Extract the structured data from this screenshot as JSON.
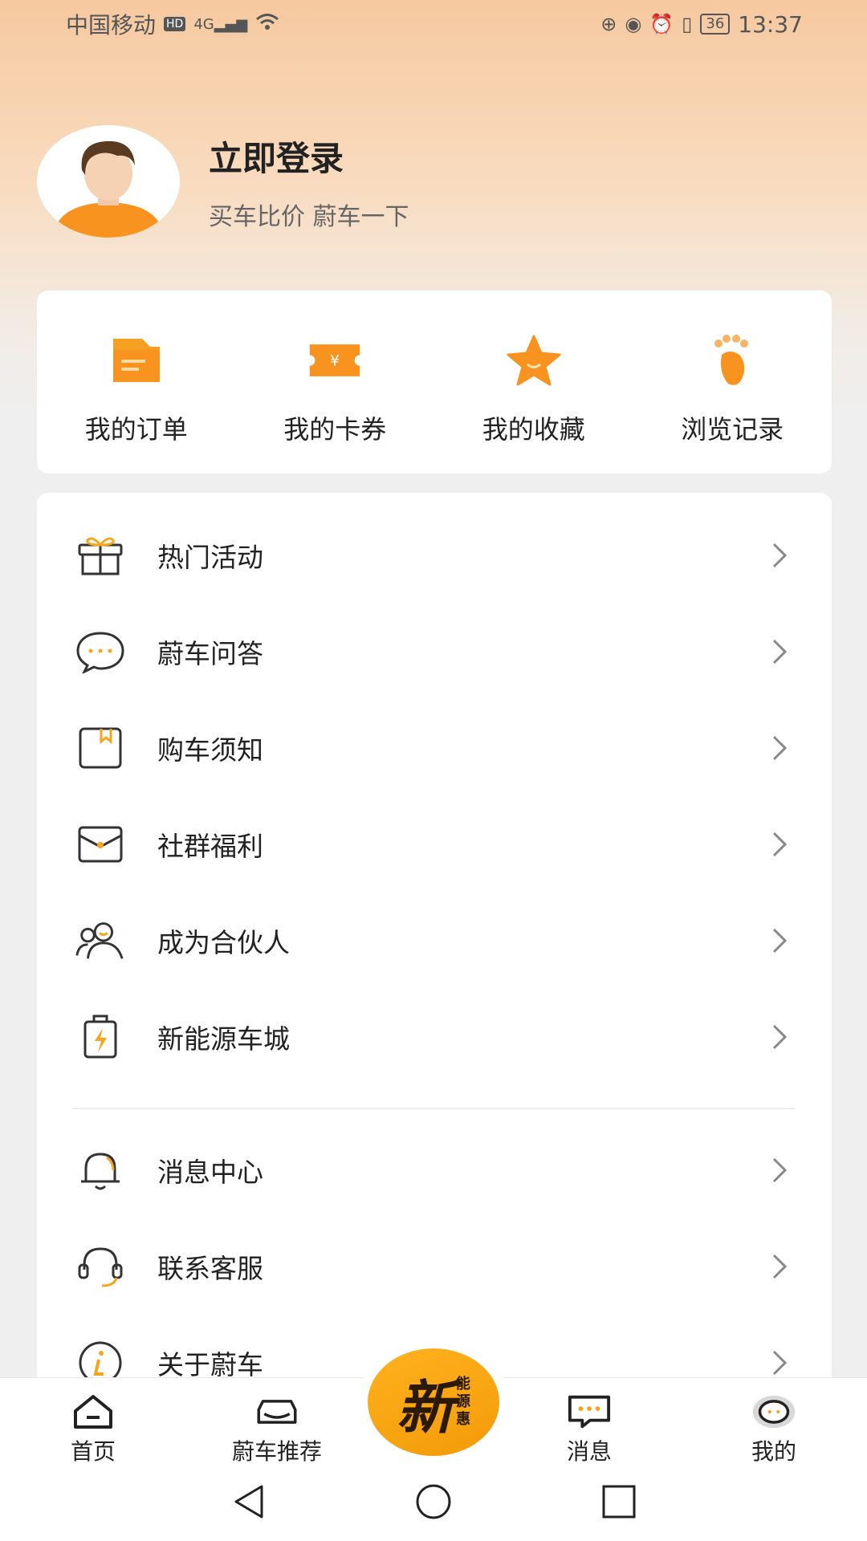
{
  "status_bar": {
    "carrier": "中国移动",
    "hd": "HD",
    "network": "4G",
    "battery": "36",
    "time": "13:37"
  },
  "profile": {
    "title": "立即登录",
    "subtitle": "买车比价 蔚车一下"
  },
  "shortcuts": [
    {
      "label": "我的订单",
      "icon": "order-icon"
    },
    {
      "label": "我的卡券",
      "icon": "coupon-icon"
    },
    {
      "label": "我的收藏",
      "icon": "star-icon"
    },
    {
      "label": "浏览记录",
      "icon": "footprint-icon"
    }
  ],
  "menu": [
    {
      "label": "热门活动",
      "icon": "gift-icon"
    },
    {
      "label": "蔚车问答",
      "icon": "chat-bubble-icon"
    },
    {
      "label": "购车须知",
      "icon": "notice-book-icon"
    },
    {
      "label": "社群福利",
      "icon": "envelope-icon"
    },
    {
      "label": "成为合伙人",
      "icon": "partner-icon"
    },
    {
      "label": "新能源车城",
      "icon": "battery-charge-icon"
    },
    {
      "label": "消息中心",
      "icon": "bell-icon"
    },
    {
      "label": "联系客服",
      "icon": "headset-icon"
    },
    {
      "label": "关于蔚车",
      "icon": "info-icon"
    }
  ],
  "tabbar": {
    "home": "首页",
    "recommend": "蔚车推荐",
    "center_big": "新",
    "center_small": [
      "能",
      "源",
      "惠"
    ],
    "messages": "消息",
    "mine": "我的"
  },
  "colors": {
    "accent": "#f7a51f",
    "text": "#222222"
  }
}
